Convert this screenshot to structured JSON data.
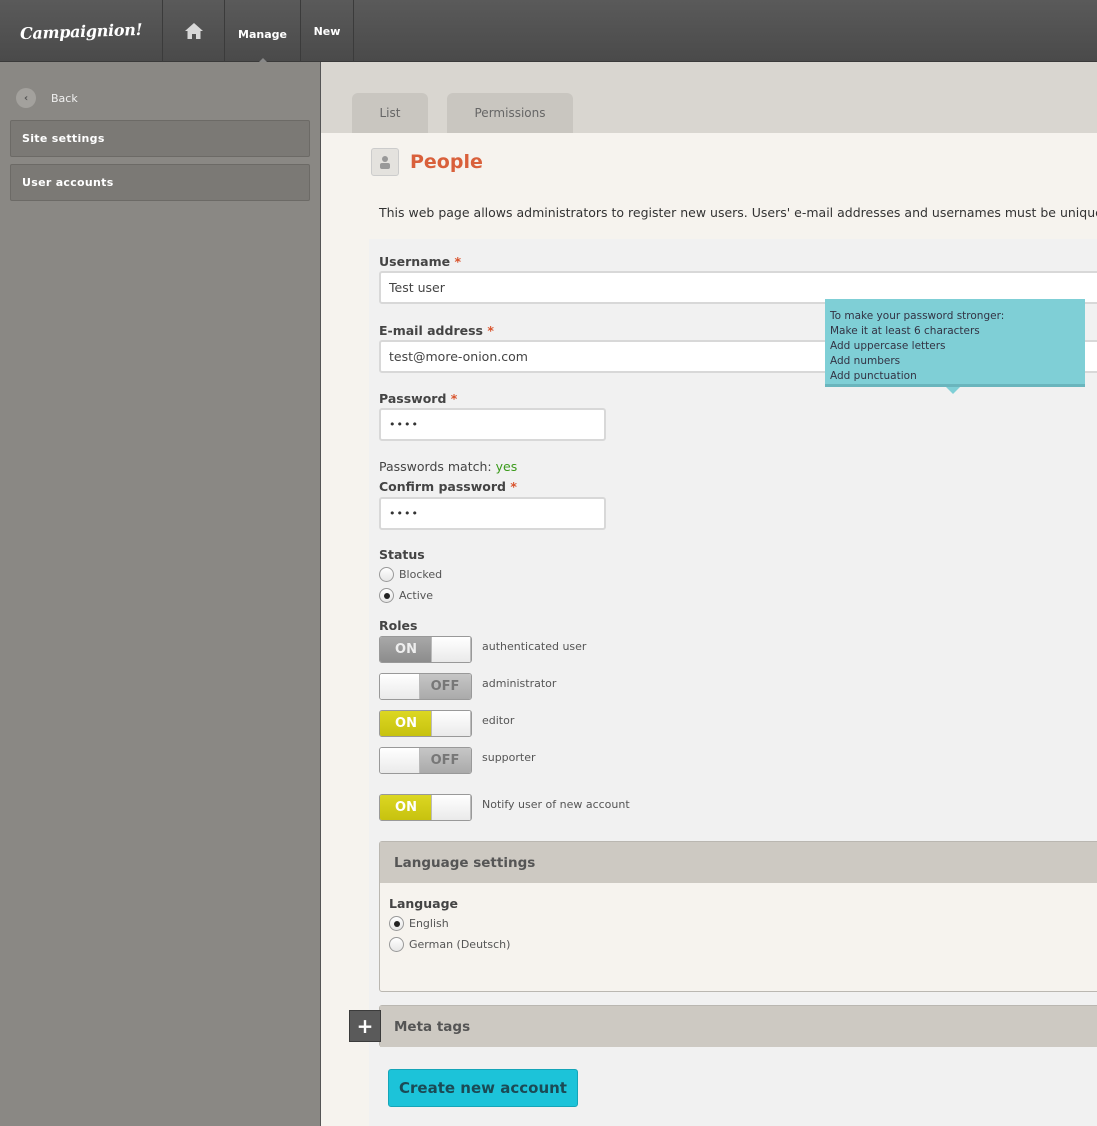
{
  "app": {
    "logo": "Campaignion!"
  },
  "topnav": {
    "home_icon": "home-icon",
    "manage": "Manage",
    "new": "New"
  },
  "sidebar": {
    "back": "Back",
    "items": [
      {
        "label": "Site settings"
      },
      {
        "label": "User accounts"
      }
    ]
  },
  "tabs": [
    {
      "label": "List"
    },
    {
      "label": "Permissions"
    }
  ],
  "page": {
    "title": "People",
    "intro": "This web page allows administrators to register new users. Users' e-mail addresses and usernames must be unique."
  },
  "form": {
    "username": {
      "label": "Username",
      "value": "Test user"
    },
    "email": {
      "label": "E-mail address",
      "value": "test@more-onion.com"
    },
    "password": {
      "label": "Password",
      "value": "••••"
    },
    "password_tooltip": {
      "heading": "To make your password stronger:",
      "tips": [
        "Make it at least 6 characters",
        "Add uppercase letters",
        "Add numbers",
        "Add punctuation"
      ]
    },
    "password_match": {
      "label": "Passwords match:",
      "value": "yes"
    },
    "confirm_password": {
      "label": "Confirm password",
      "value": "••••"
    },
    "required_mark": "*",
    "status": {
      "label": "Status",
      "options": [
        {
          "label": "Blocked",
          "selected": false
        },
        {
          "label": "Active",
          "selected": true
        }
      ]
    },
    "roles": {
      "label": "Roles",
      "items": [
        {
          "label": "authenticated user",
          "state": "ON",
          "disabled": true
        },
        {
          "label": "administrator",
          "state": "OFF"
        },
        {
          "label": "editor",
          "state": "ON"
        },
        {
          "label": "supporter",
          "state": "OFF"
        }
      ]
    },
    "notify": {
      "label": "Notify user of new account",
      "state": "ON"
    },
    "toggle_text": {
      "on": "ON",
      "off": "OFF"
    },
    "language_settings": {
      "legend": "Language settings",
      "label": "Language",
      "options": [
        {
          "label": "English",
          "selected": true
        },
        {
          "label": "German (Deutsch)",
          "selected": false
        }
      ]
    },
    "meta_tags": {
      "legend": "Meta tags",
      "expand_icon": "plus-icon",
      "expand_symbol": "+"
    },
    "submit": "Create new account"
  },
  "colors": {
    "accent_title": "#d9603b",
    "toggle_on": "#d4cf14",
    "toggle_on_disabled": "#9a9a9a",
    "tooltip_bg": "#7fcfd6",
    "submit_bg": "#1cc3d9",
    "match_ok": "#3a9a1a"
  }
}
